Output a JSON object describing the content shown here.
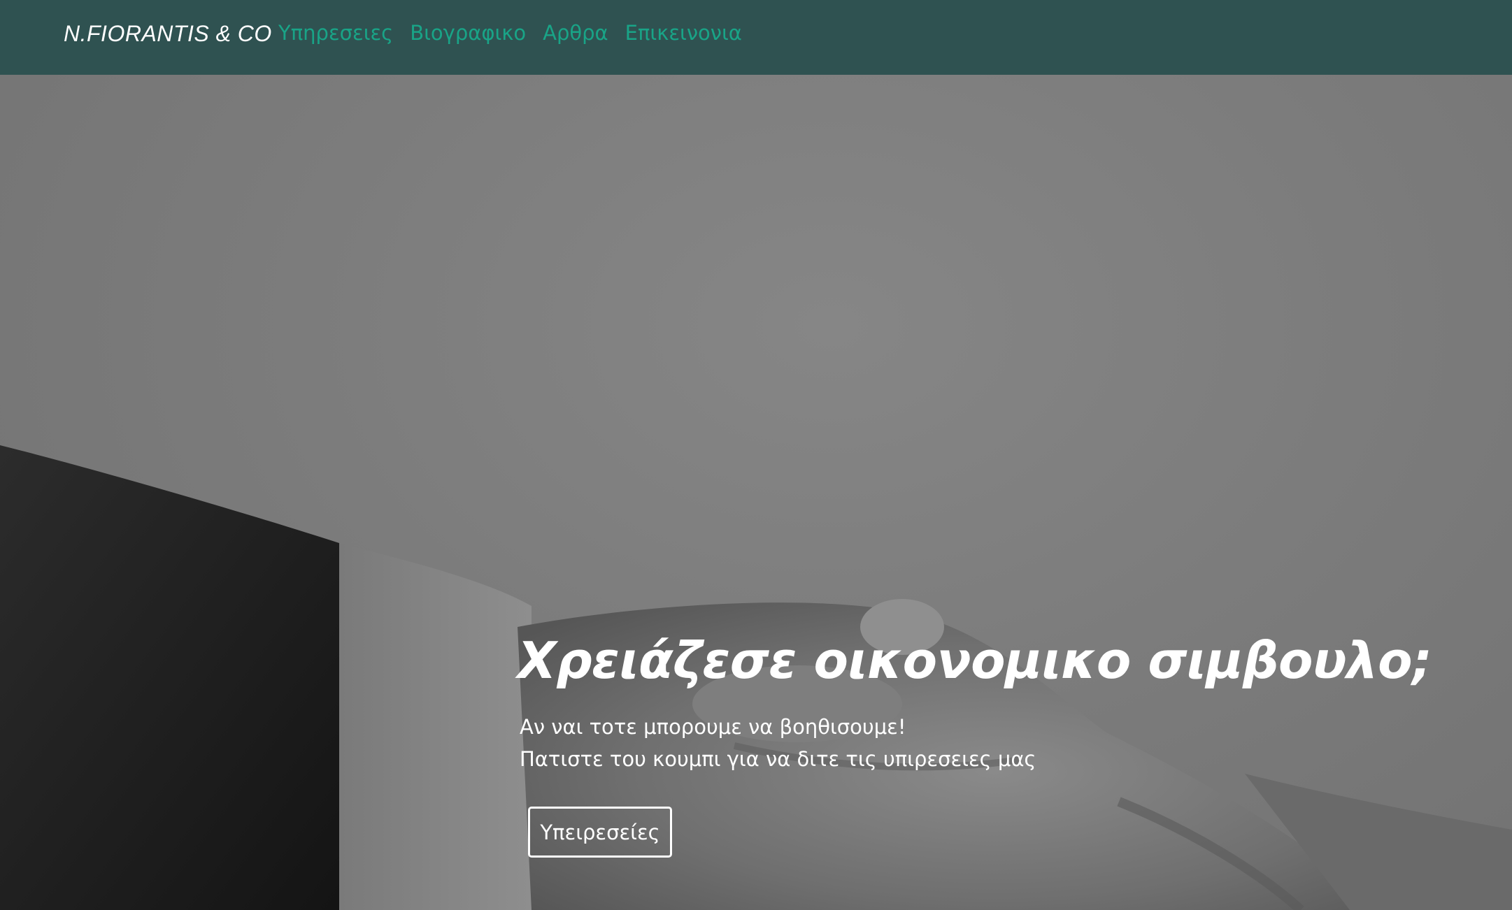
{
  "navbar": {
    "brand": "N.FIORANTIS & CO",
    "links": [
      {
        "label": "Υπηρεσειες"
      },
      {
        "label": "Βιογραφικο"
      },
      {
        "label": "Αρθρα"
      },
      {
        "label": "Επικεινονια"
      }
    ]
  },
  "hero": {
    "title": "Χρειάζεσε οικονομικο σιμβουλο;",
    "subtitle_line1": "Αν ναι τοτε μπορουμε να βοηθισουμε!",
    "subtitle_line2": "Πατιστε του κουμπι για να διτε τις υπιρεσειες μας",
    "button_label": "Υπειρεσείες"
  },
  "colors": {
    "navbar_bg": "#2f5251",
    "nav_link": "#19a487",
    "brand_text": "#ffffff",
    "hero_text": "#ffffff"
  }
}
